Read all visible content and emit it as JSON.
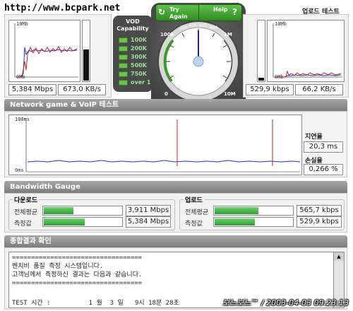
{
  "watermark_top": "http://www.bcpark.net",
  "watermark_bottom": "보느보느™ / 2003-04-03 09:23:13",
  "download": {
    "graph_top_label": "10Mb",
    "graph_bottom_label": "0Mb",
    "rate_mbps": "5,384 Mbps",
    "rate_kbs": "673,0 KB/s"
  },
  "upload": {
    "title": "업로드 테스트",
    "graph_top_label": "10Mb",
    "graph_bottom_label": "0Mb",
    "rate_kbps": "529,9 kbps",
    "rate_kbs": "66,2 KB/s"
  },
  "vod": {
    "title_line1": "VOD",
    "title_line2": "Capability",
    "levels": [
      "100K",
      "200K",
      "300K",
      "500K",
      "750K",
      "over 1M"
    ]
  },
  "controls": {
    "try_again": "Try Again",
    "help": "Help",
    "help_icon": "?"
  },
  "dial": {
    "labels": [
      "200",
      "400",
      "600",
      "800",
      "1M",
      "100k",
      "0",
      "10M"
    ],
    "needle_value_label": "600"
  },
  "network": {
    "title": "Network game & VoIP 테스트",
    "graph_top_label": "100ms",
    "graph_bottom_label": "0ms",
    "latency_label": "지연율",
    "latency_value": "20,3 ms",
    "loss_label": "손실율",
    "loss_value": "0,266 %"
  },
  "bandwidth": {
    "title": "Bandwidth Gauge",
    "download_label": "다운로드",
    "upload_label": "업로드",
    "avg_label": "전체평균",
    "measured_label": "측정값",
    "download_avg": "3,911 Mbps",
    "download_measured": "5,384 Mbps",
    "upload_avg": "565,7 kbps",
    "upload_measured": "529,9 kbps",
    "download_avg_fill": 0.39,
    "download_measured_fill": 0.54,
    "upload_avg_fill": 0.57,
    "upload_measured_fill": 0.53
  },
  "result": {
    "title": "종합결과 확인",
    "lines": [
      "==================================",
      "벤치비 품질 측정 시스템입니다.",
      "고객님께서 측정하신 결과는 다음과 같습니다.",
      "==================================",
      "",
      "TEST 시간 :          1 월  3 일   9시 18분 28초"
    ]
  },
  "colors": {
    "accent_green": "#3c9a2a",
    "signal_red": "#cc2222",
    "signal_blue": "#2233cc",
    "title_bar": "#8c8c8c"
  }
}
